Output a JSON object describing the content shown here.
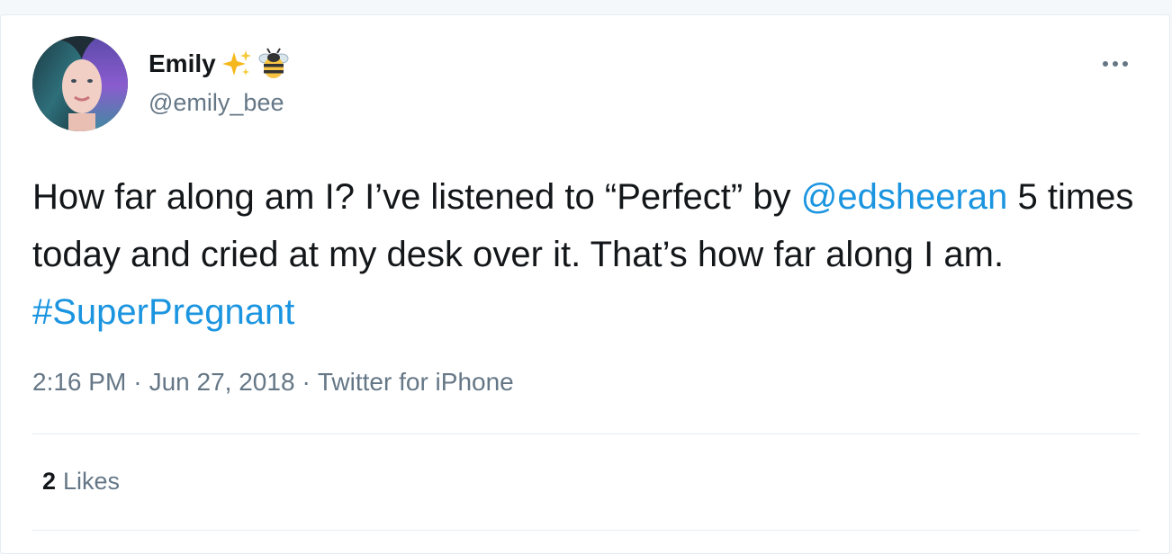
{
  "tweet": {
    "author": {
      "display_name": "Emily",
      "name_emojis": [
        "sparkles-emoji",
        "bee-emoji"
      ],
      "handle": "@emily_bee"
    },
    "more_icon": "ellipsis-icon",
    "text": {
      "part1": "How far along am I? I’ve listened to “Perfect” by ",
      "mention": "@edsheeran",
      "part2": " 5 times today and cried at my desk over it. That’s how far along I am. ",
      "hashtag": "#SuperPregnant"
    },
    "meta": {
      "time": "2:16 PM",
      "separator": "·",
      "date": "Jun 27, 2018",
      "source": "Twitter for iPhone"
    },
    "likes": {
      "count": "2",
      "label": "Likes"
    }
  },
  "colors": {
    "link": "#1b95e0",
    "secondary_text": "#657786",
    "primary_text": "#14171a",
    "border": "#e6ecf0"
  }
}
